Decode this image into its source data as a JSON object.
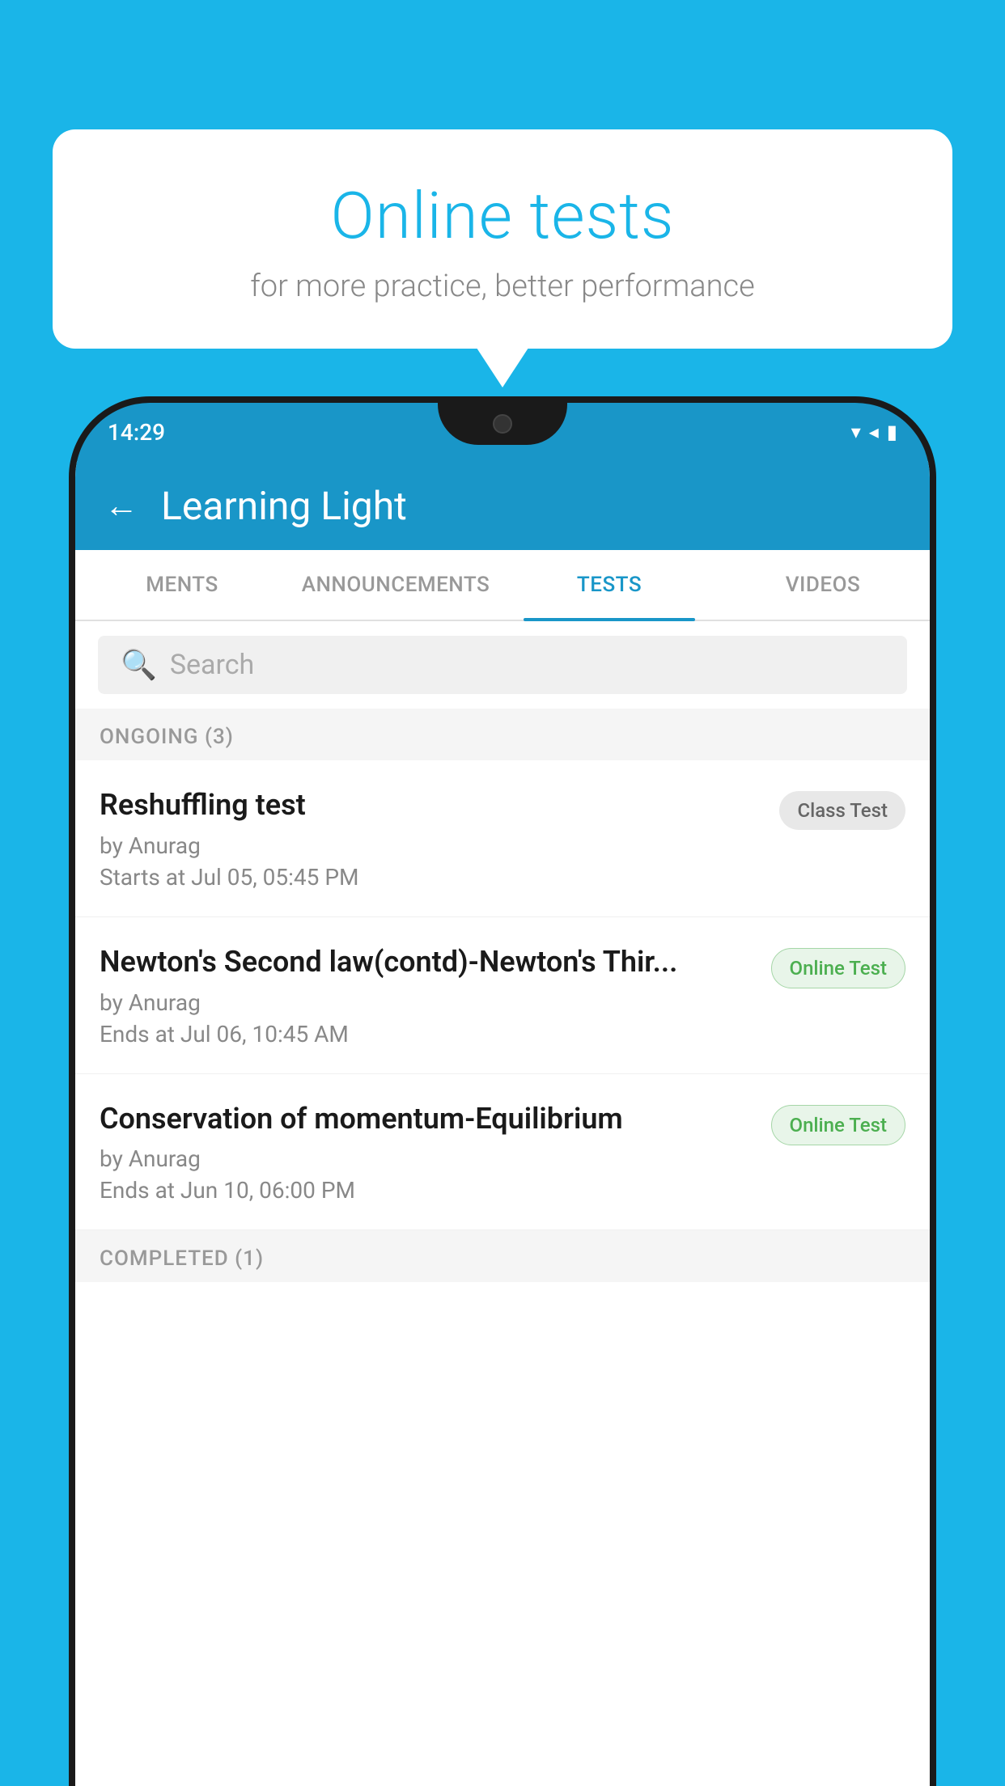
{
  "background_color": "#1ab5e8",
  "bubble": {
    "title": "Online tests",
    "subtitle": "for more practice, better performance"
  },
  "status_bar": {
    "time": "14:29",
    "wifi_icon": "▼",
    "signal_icon": "◀",
    "battery_icon": "▮"
  },
  "app_bar": {
    "back_label": "←",
    "title": "Learning Light"
  },
  "tabs": [
    {
      "label": "MENTS",
      "active": false
    },
    {
      "label": "ANNOUNCEMENTS",
      "active": false
    },
    {
      "label": "TESTS",
      "active": true
    },
    {
      "label": "VIDEOS",
      "active": false
    }
  ],
  "search": {
    "placeholder": "Search"
  },
  "ongoing_section": {
    "label": "ONGOING (3)"
  },
  "tests": [
    {
      "title": "Reshuffling test",
      "author": "by Anurag",
      "time_label": "Starts at",
      "time_value": "Jul 05, 05:45 PM",
      "badge": "Class Test",
      "badge_type": "class"
    },
    {
      "title": "Newton's Second law(contd)-Newton's Thir...",
      "author": "by Anurag",
      "time_label": "Ends at",
      "time_value": "Jul 06, 10:45 AM",
      "badge": "Online Test",
      "badge_type": "online"
    },
    {
      "title": "Conservation of momentum-Equilibrium",
      "author": "by Anurag",
      "time_label": "Ends at",
      "time_value": "Jun 10, 06:00 PM",
      "badge": "Online Test",
      "badge_type": "online"
    }
  ],
  "completed_section": {
    "label": "COMPLETED (1)"
  }
}
